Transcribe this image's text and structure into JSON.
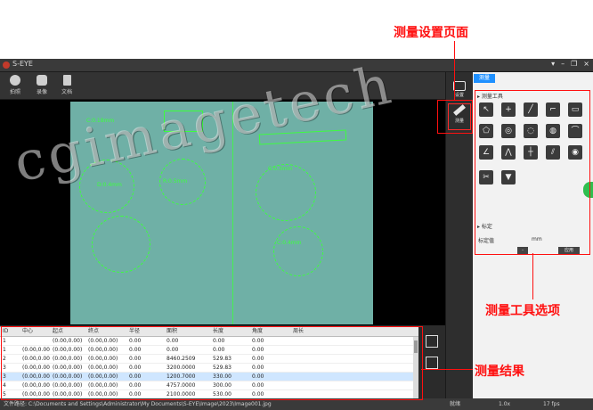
{
  "app": {
    "title": "S-EYE"
  },
  "window_controls": [
    "▾",
    "–",
    "❐",
    "×"
  ],
  "toolbar": {
    "items": [
      {
        "name": "capture",
        "label": "拍照"
      },
      {
        "name": "record",
        "label": "录像"
      },
      {
        "name": "file",
        "label": "文档"
      }
    ]
  },
  "image": {
    "labels": [
      "C:0.18mm",
      "D:0.4mm",
      "C:0.3mm",
      "R:0.5mm",
      "C:0.4mm"
    ]
  },
  "side_tools": {
    "settings_label": "设置",
    "measure_label": "测量"
  },
  "panel": {
    "tab": "测量",
    "tools_section": "▸ 测量工具",
    "tools": [
      "↖",
      "+",
      "╱",
      "⌐",
      "▭",
      "⬠",
      "◎",
      "◌",
      "◍",
      "⌒",
      "∠",
      "⋀",
      "┼",
      "⫽",
      "◉",
      "✂",
      "▼"
    ],
    "settings_section": "▸ 标定",
    "setting_label": "标定值",
    "setting_unit": "mm",
    "button_small": "-",
    "button_apply": "应用"
  },
  "results": {
    "columns": [
      "ID",
      "中心",
      "起点",
      "终点",
      "半径",
      "面积",
      "长度",
      "角度",
      "周长"
    ],
    "rows": [
      [
        "1",
        "",
        "(0.00,0.00)",
        "(0.00,0.00)",
        "0.00",
        "0.00",
        "0.00",
        "0.00",
        ""
      ],
      [
        "1",
        "(0.00,0.00)",
        "(0.00,0.00)",
        "(0.00,0.00)",
        "0.00",
        "0.00",
        "0.00",
        "0.00",
        ""
      ],
      [
        "2",
        "(0.00,0.00)",
        "(0.00,0.00)",
        "(0.00,0.00)",
        "0.00",
        "8460.2509",
        "529.83",
        "0.00",
        ""
      ],
      [
        "3",
        "(0.00,0.00)",
        "(0.00,0.00)",
        "(0.00,0.00)",
        "0.00",
        "3200.0000",
        "529.83",
        "0.00",
        ""
      ],
      [
        "3",
        "(0.00,0.00)",
        "(0.00,0.00)",
        "(0.00,0.00)",
        "0.00",
        "1200.7000",
        "330.00",
        "0.00",
        ""
      ],
      [
        "4",
        "(0.00,0.00)",
        "(0.00,0.00)",
        "(0.00,0.00)",
        "0.00",
        "4757.0000",
        "300.00",
        "0.00",
        ""
      ],
      [
        "5",
        "(0.00,0.00)",
        "(0.00,0.00)",
        "(0.00,0.00)",
        "0.00",
        "2100.0000",
        "530.00",
        "0.00",
        ""
      ]
    ]
  },
  "status": {
    "path": "文件路径: C:\\Documents and Settings\\Administrator\\My Documents\\S-EYE\\Image\\2023\\Image001.jpg",
    "left_item": "就绪",
    "mid_item": "1.0x",
    "right_item": "17 fps"
  },
  "annotations": {
    "settings_page": "测量设置页面",
    "tool_options": "测量工具选项",
    "results": "测量结果"
  },
  "watermark": "cgimagetech"
}
